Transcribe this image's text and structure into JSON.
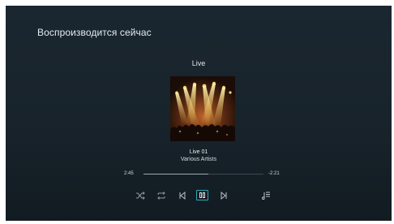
{
  "screen": {
    "title": "Воспроизводится сейчас"
  },
  "album": {
    "heading": "Live",
    "artwork_icon": "album-art-concert-stage"
  },
  "track": {
    "title": "Live 01",
    "artist": "Various Artists"
  },
  "progress": {
    "elapsed": "2:45",
    "remaining": "-2:21",
    "fraction": 0.54
  },
  "controls": [
    {
      "name": "shuffle-icon"
    },
    {
      "name": "repeat-icon"
    },
    {
      "name": "previous-icon"
    },
    {
      "name": "pause-icon",
      "selected": true
    },
    {
      "name": "next-icon"
    },
    {
      "name": "queue-icon"
    }
  ],
  "colors": {
    "background": "#1a252d",
    "accent": "#2fa7b2",
    "text": "#e4ebef",
    "icon": "#8f9ca4"
  }
}
